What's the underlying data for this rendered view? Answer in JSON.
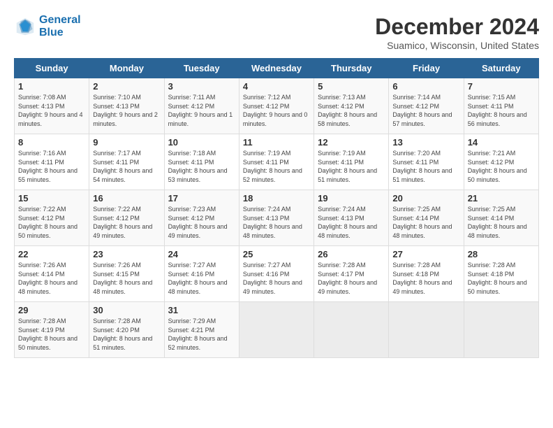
{
  "header": {
    "logo_line1": "General",
    "logo_line2": "Blue",
    "title": "December 2024",
    "subtitle": "Suamico, Wisconsin, United States"
  },
  "days_of_week": [
    "Sunday",
    "Monday",
    "Tuesday",
    "Wednesday",
    "Thursday",
    "Friday",
    "Saturday"
  ],
  "weeks": [
    [
      {
        "day": "1",
        "sunrise": "7:08 AM",
        "sunset": "4:13 PM",
        "daylight": "9 hours and 4 minutes."
      },
      {
        "day": "2",
        "sunrise": "7:10 AM",
        "sunset": "4:13 PM",
        "daylight": "9 hours and 2 minutes."
      },
      {
        "day": "3",
        "sunrise": "7:11 AM",
        "sunset": "4:12 PM",
        "daylight": "9 hours and 1 minute."
      },
      {
        "day": "4",
        "sunrise": "7:12 AM",
        "sunset": "4:12 PM",
        "daylight": "9 hours and 0 minutes."
      },
      {
        "day": "5",
        "sunrise": "7:13 AM",
        "sunset": "4:12 PM",
        "daylight": "8 hours and 58 minutes."
      },
      {
        "day": "6",
        "sunrise": "7:14 AM",
        "sunset": "4:12 PM",
        "daylight": "8 hours and 57 minutes."
      },
      {
        "day": "7",
        "sunrise": "7:15 AM",
        "sunset": "4:11 PM",
        "daylight": "8 hours and 56 minutes."
      }
    ],
    [
      {
        "day": "8",
        "sunrise": "7:16 AM",
        "sunset": "4:11 PM",
        "daylight": "8 hours and 55 minutes."
      },
      {
        "day": "9",
        "sunrise": "7:17 AM",
        "sunset": "4:11 PM",
        "daylight": "8 hours and 54 minutes."
      },
      {
        "day": "10",
        "sunrise": "7:18 AM",
        "sunset": "4:11 PM",
        "daylight": "8 hours and 53 minutes."
      },
      {
        "day": "11",
        "sunrise": "7:19 AM",
        "sunset": "4:11 PM",
        "daylight": "8 hours and 52 minutes."
      },
      {
        "day": "12",
        "sunrise": "7:19 AM",
        "sunset": "4:11 PM",
        "daylight": "8 hours and 51 minutes."
      },
      {
        "day": "13",
        "sunrise": "7:20 AM",
        "sunset": "4:11 PM",
        "daylight": "8 hours and 51 minutes."
      },
      {
        "day": "14",
        "sunrise": "7:21 AM",
        "sunset": "4:12 PM",
        "daylight": "8 hours and 50 minutes."
      }
    ],
    [
      {
        "day": "15",
        "sunrise": "7:22 AM",
        "sunset": "4:12 PM",
        "daylight": "8 hours and 50 minutes."
      },
      {
        "day": "16",
        "sunrise": "7:22 AM",
        "sunset": "4:12 PM",
        "daylight": "8 hours and 49 minutes."
      },
      {
        "day": "17",
        "sunrise": "7:23 AM",
        "sunset": "4:12 PM",
        "daylight": "8 hours and 49 minutes."
      },
      {
        "day": "18",
        "sunrise": "7:24 AM",
        "sunset": "4:13 PM",
        "daylight": "8 hours and 48 minutes."
      },
      {
        "day": "19",
        "sunrise": "7:24 AM",
        "sunset": "4:13 PM",
        "daylight": "8 hours and 48 minutes."
      },
      {
        "day": "20",
        "sunrise": "7:25 AM",
        "sunset": "4:14 PM",
        "daylight": "8 hours and 48 minutes."
      },
      {
        "day": "21",
        "sunrise": "7:25 AM",
        "sunset": "4:14 PM",
        "daylight": "8 hours and 48 minutes."
      }
    ],
    [
      {
        "day": "22",
        "sunrise": "7:26 AM",
        "sunset": "4:14 PM",
        "daylight": "8 hours and 48 minutes."
      },
      {
        "day": "23",
        "sunrise": "7:26 AM",
        "sunset": "4:15 PM",
        "daylight": "8 hours and 48 minutes."
      },
      {
        "day": "24",
        "sunrise": "7:27 AM",
        "sunset": "4:16 PM",
        "daylight": "8 hours and 48 minutes."
      },
      {
        "day": "25",
        "sunrise": "7:27 AM",
        "sunset": "4:16 PM",
        "daylight": "8 hours and 49 minutes."
      },
      {
        "day": "26",
        "sunrise": "7:28 AM",
        "sunset": "4:17 PM",
        "daylight": "8 hours and 49 minutes."
      },
      {
        "day": "27",
        "sunrise": "7:28 AM",
        "sunset": "4:18 PM",
        "daylight": "8 hours and 49 minutes."
      },
      {
        "day": "28",
        "sunrise": "7:28 AM",
        "sunset": "4:18 PM",
        "daylight": "8 hours and 50 minutes."
      }
    ],
    [
      {
        "day": "29",
        "sunrise": "7:28 AM",
        "sunset": "4:19 PM",
        "daylight": "8 hours and 50 minutes."
      },
      {
        "day": "30",
        "sunrise": "7:28 AM",
        "sunset": "4:20 PM",
        "daylight": "8 hours and 51 minutes."
      },
      {
        "day": "31",
        "sunrise": "7:29 AM",
        "sunset": "4:21 PM",
        "daylight": "8 hours and 52 minutes."
      },
      null,
      null,
      null,
      null
    ]
  ]
}
